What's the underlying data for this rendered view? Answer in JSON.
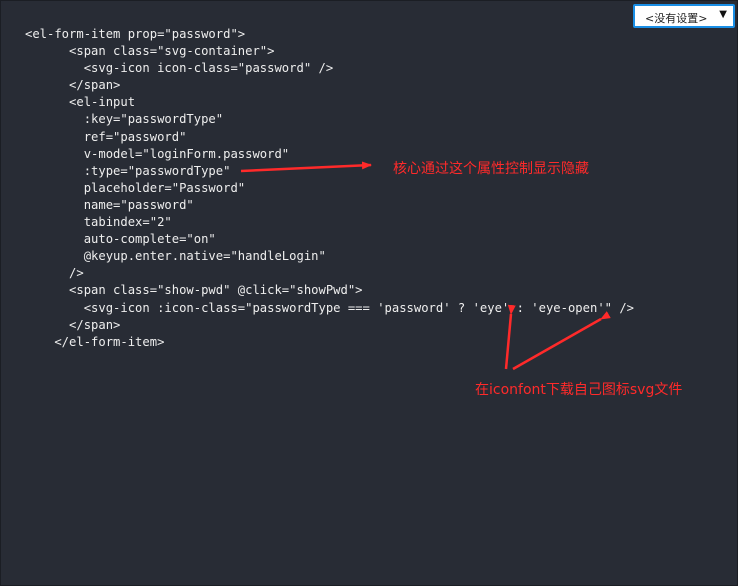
{
  "language_select": {
    "selected": "<没有设置>",
    "caret": "▼"
  },
  "code_lines": [
    "<el-form-item prop=\"password\">",
    "      <span class=\"svg-container\">",
    "        <svg-icon icon-class=\"password\" />",
    "      </span>",
    "      <el-input",
    "        :key=\"passwordType\"",
    "        ref=\"password\"",
    "        v-model=\"loginForm.password\"",
    "        :type=\"passwordType\"",
    "        placeholder=\"Password\"",
    "        name=\"password\"",
    "        tabindex=\"2\"",
    "        auto-complete=\"on\"",
    "        @keyup.enter.native=\"handleLogin\"",
    "      />",
    "      <span class=\"show-pwd\" @click=\"showPwd\">",
    "        <svg-icon :icon-class=\"passwordType === 'password' ? 'eye' : 'eye-open'\" />",
    "      </span>",
    "    </el-form-item>"
  ],
  "annotations": {
    "note_1": "核心通过这个属性控制显示隐藏",
    "note_2": "在iconfont下载自己图标svg文件",
    "arrow_color": "#ff2a2a"
  }
}
